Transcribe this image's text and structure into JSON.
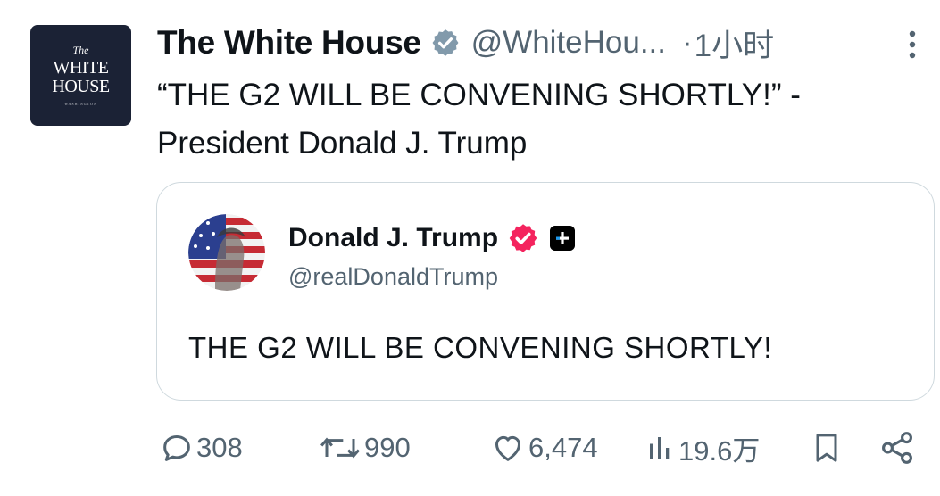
{
  "author": {
    "avatar_lines": [
      "The",
      "WHITE",
      "HOUSE",
      "WASHINGTON"
    ],
    "name": "The White House",
    "handle": "@WhiteHou...",
    "separator": "·",
    "time": "1小时"
  },
  "tweet": {
    "text": "“THE G2 WILL BE CONVENING SHORTLY!” - President Donald J. Trump"
  },
  "quote": {
    "name": "Donald J. Trump",
    "handle": "@realDonaldTrump",
    "text": "THE G2 WILL BE CONVENING SHORTLY!"
  },
  "actions": {
    "replies": "308",
    "reposts": "990",
    "likes": "6,474",
    "views": "19.6万"
  },
  "colors": {
    "text": "#0f1419",
    "secondary": "#536471",
    "border": "#cfd9de",
    "verified_gray": "#829aab",
    "verified_pink": "#f4245e",
    "avatar_navy": "#1b2235"
  },
  "icons": [
    "verified-gray-icon",
    "more-icon",
    "verified-pink-icon",
    "affiliate-icon",
    "reply-icon",
    "repost-icon",
    "like-icon",
    "views-icon",
    "bookmark-icon",
    "share-icon"
  ]
}
